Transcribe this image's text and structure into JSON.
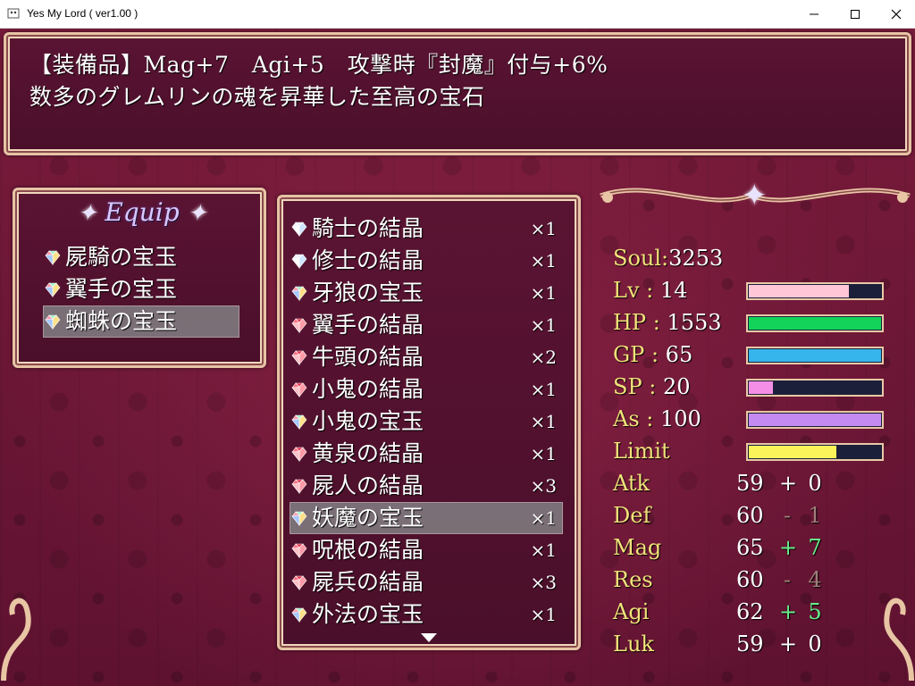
{
  "window": {
    "title": "Yes My Lord ( ver1.00 )",
    "controls": {
      "minimize": "minimize-icon",
      "maximize": "maximize-icon",
      "close": "close-icon"
    }
  },
  "help": {
    "line1": "【装備品】Mag+7　Agi+5　攻撃時『封魔』付与+6%",
    "line2": "数多のグレムリンの魂を昇華した至高の宝石"
  },
  "equip": {
    "title": "Equip",
    "slots": [
      {
        "name": "屍騎の宝玉",
        "gem": "rainbow",
        "selected": false
      },
      {
        "name": "翼手の宝玉",
        "gem": "rainbow",
        "selected": false
      },
      {
        "name": "蜘蛛の宝玉",
        "gem": "rainbow",
        "selected": true
      }
    ]
  },
  "inventory": {
    "items": [
      {
        "name": "騎士の結晶",
        "qty": "×1",
        "gem": "pale",
        "selected": false
      },
      {
        "name": "修士の結晶",
        "qty": "×1",
        "gem": "pale",
        "selected": false
      },
      {
        "name": "牙狼の宝玉",
        "qty": "×1",
        "gem": "rainbow",
        "selected": false
      },
      {
        "name": "翼手の結晶",
        "qty": "×1",
        "gem": "red",
        "selected": false
      },
      {
        "name": "牛頭の結晶",
        "qty": "×2",
        "gem": "red",
        "selected": false
      },
      {
        "name": "小鬼の結晶",
        "qty": "×1",
        "gem": "red",
        "selected": false
      },
      {
        "name": "小鬼の宝玉",
        "qty": "×1",
        "gem": "rainbow",
        "selected": false
      },
      {
        "name": "黄泉の結晶",
        "qty": "×1",
        "gem": "red",
        "selected": false
      },
      {
        "name": "屍人の結晶",
        "qty": "×3",
        "gem": "red",
        "selected": false
      },
      {
        "name": "妖魔の宝玉",
        "qty": "×1",
        "gem": "rainbow",
        "selected": true
      },
      {
        "name": "呪根の結晶",
        "qty": "×1",
        "gem": "red",
        "selected": false
      },
      {
        "name": "屍兵の結晶",
        "qty": "×3",
        "gem": "red",
        "selected": false
      },
      {
        "name": "外法の宝玉",
        "qty": "×1",
        "gem": "rainbow",
        "selected": false
      }
    ],
    "more_indicator": "scroll-down-arrow-icon"
  },
  "status": {
    "soul_label": "Soul",
    "soul_value": "3253",
    "gauges": [
      {
        "label": "Lv",
        "value": "14",
        "fill": 0.76,
        "color": "#ffc6d8"
      },
      {
        "label": "HP",
        "value": "1553",
        "fill": 1.0,
        "color": "#14d35a"
      },
      {
        "label": "GP",
        "value": "65",
        "fill": 1.0,
        "color": "#36b4ec"
      },
      {
        "label": "SP",
        "value": "20",
        "fill": 0.18,
        "color": "#f58ee6"
      },
      {
        "label": "As",
        "value": "100",
        "fill": 1.0,
        "color": "#c48af2"
      },
      {
        "label": "Limit",
        "value": "",
        "fill": 0.66,
        "color": "#fbf35a"
      }
    ],
    "params": [
      {
        "name": "Atk",
        "base": "59",
        "sign": "+",
        "bonus": "0",
        "tone": "neutral"
      },
      {
        "name": "Def",
        "base": "60",
        "sign": "-",
        "bonus": "1",
        "tone": "down"
      },
      {
        "name": "Mag",
        "base": "65",
        "sign": "+",
        "bonus": "7",
        "tone": "up"
      },
      {
        "name": "Res",
        "base": "60",
        "sign": "-",
        "bonus": "4",
        "tone": "down"
      },
      {
        "name": "Agi",
        "base": "62",
        "sign": "+",
        "bonus": "5",
        "tone": "up"
      },
      {
        "name": "Luk",
        "base": "59",
        "sign": "+",
        "bonus": "0",
        "tone": "neutral"
      }
    ]
  },
  "colors": {
    "up": "#67f08a",
    "down": "#a07e7a",
    "neutral": "#ffffff",
    "label_gold": "#f2e27a"
  }
}
